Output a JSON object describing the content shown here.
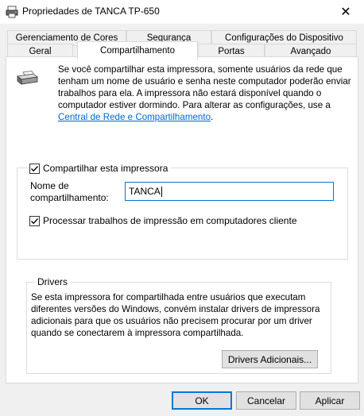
{
  "window": {
    "title": "Propriedades de TANCA TP-650",
    "close_symbol": "✕"
  },
  "tabs": {
    "row_back": [
      {
        "label": "Gerenciamento de Cores"
      },
      {
        "label": "Segurança"
      },
      {
        "label": "Configurações do Dispositivo"
      }
    ],
    "row_front": [
      {
        "label": "Geral"
      },
      {
        "label": "Compartilhamento",
        "active": true
      },
      {
        "label": "Portas"
      },
      {
        "label": "Avançado"
      }
    ]
  },
  "sharing": {
    "description": "Se você compartilhar esta impressora, somente usuários da rede que tenham um nome de usuário e senha neste computador poderão enviar trabalhos para ela. A impressora não estará disponível quando o computador estiver dormindo. Para alterar as configurações, use a",
    "link_text": "Central de Rede e Compartilhamento",
    "link_suffix": ".",
    "share_checkbox_label": "Compartilhar esta impressora",
    "share_checked": true,
    "share_name_label_1": "Nome de",
    "share_name_label_2": "compartilhamento:",
    "share_name_value": "TANCA",
    "render_jobs_label": "Processar trabalhos de impressão em computadores cliente",
    "render_jobs_checked": true
  },
  "drivers": {
    "legend": "Drivers",
    "text": "Se esta impressora for compartilhada entre usuários que executam diferentes versões do Windows, convém instalar drivers de impressora adicionais para que os usuários não precisem procurar por um driver quando se conectarem à impressora compartilhada.",
    "additional_button": "Drivers Adicionais..."
  },
  "footer": {
    "ok": "OK",
    "cancel": "Cancelar",
    "apply": "Aplicar"
  },
  "icons": {
    "title_icon": "printer-icon",
    "panel_icon": "printer-icon"
  }
}
